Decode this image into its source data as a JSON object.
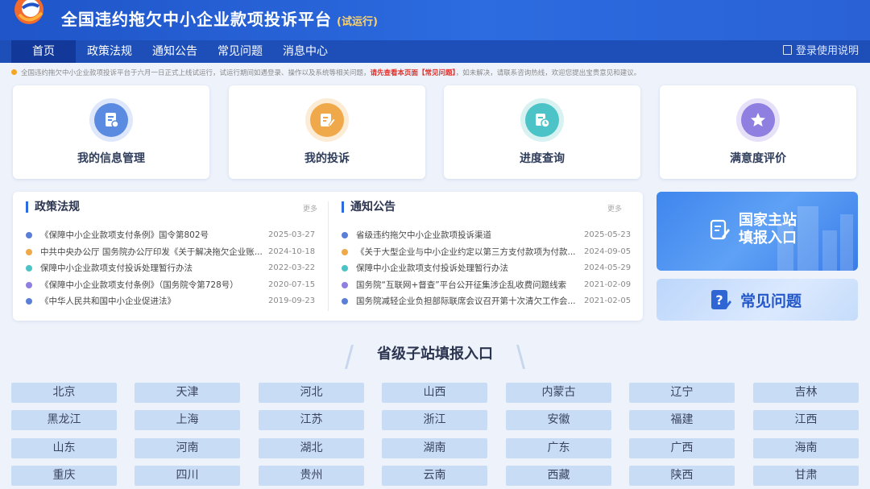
{
  "header": {
    "title": "全国违约拖欠中小企业款项投诉平台",
    "badge": "(试运行)"
  },
  "nav": {
    "items": [
      "首页",
      "政策法规",
      "通知公告",
      "常见问题",
      "消息中心"
    ],
    "login": "登录使用说明"
  },
  "notice": {
    "text_before": "全国违约拖欠中小企业款项投诉平台于六月一日正式上线试运行，试运行期间如遇登录、操作以及系统等相关问题，",
    "highlight": "请先查看本页面【常见问题】",
    "text_after": "，如未解决，请联系咨询热线，欢迎您提出宝贵意见和建议。"
  },
  "cards": [
    {
      "label": "我的信息管理",
      "icon": "profile-doc-icon",
      "color": "#5b8be0"
    },
    {
      "label": "我的投诉",
      "icon": "complaint-edit-icon",
      "color": "#f0a94a"
    },
    {
      "label": "进度查询",
      "icon": "progress-clock-icon",
      "color": "#4cc3c6"
    },
    {
      "label": "满意度评价",
      "icon": "star-icon",
      "color": "#8f7fe0"
    }
  ],
  "policy": {
    "title": "政策法规",
    "more": "更多",
    "items": [
      {
        "text": "《保障中小企业款项支付条例》国令第802号",
        "date": "2025-03-27",
        "color": "#5b7fd6"
      },
      {
        "text": "中共中央办公厅 国务院办公厅印发《关于解决拖欠企业账...",
        "date": "2024-10-18",
        "color": "#f0a94a"
      },
      {
        "text": "保障中小企业款项支付投诉处理暂行办法",
        "date": "2022-03-22",
        "color": "#4cc3c6"
      },
      {
        "text": "《保障中小企业款项支付条例》（国务院令第728号）",
        "date": "2020-07-15",
        "color": "#8f7fe0"
      },
      {
        "text": "《中华人民共和国中小企业促进法》",
        "date": "2019-09-23",
        "color": "#5b7fd6"
      }
    ]
  },
  "announce": {
    "title": "通知公告",
    "more": "更多",
    "items": [
      {
        "text": "省级违约拖欠中小企业款项投诉渠道",
        "date": "2025-05-23",
        "color": "#5b7fd6"
      },
      {
        "text": "《关于大型企业与中小企业约定以第三方支付款项为付款...",
        "date": "2024-09-05",
        "color": "#f0a94a"
      },
      {
        "text": "保障中小企业款项支付投诉处理暂行办法",
        "date": "2024-05-29",
        "color": "#4cc3c6"
      },
      {
        "text": "国务院“互联网+督查”平台公开征集涉企乱收费问题线索",
        "date": "2021-02-09",
        "color": "#8f7fe0"
      },
      {
        "text": "国务院减轻企业负担部际联席会议召开第十次清欠工作会...",
        "date": "2021-02-05",
        "color": "#5b7fd6"
      }
    ]
  },
  "side": {
    "main_line1": "国家主站",
    "main_line2": "填报入口",
    "faq": "常见问题"
  },
  "provinces": {
    "title": "省级子站填报入口",
    "items": [
      "北京",
      "天津",
      "河北",
      "山西",
      "内蒙古",
      "辽宁",
      "吉林",
      "黑龙江",
      "上海",
      "江苏",
      "浙江",
      "安徽",
      "福建",
      "江西",
      "山东",
      "河南",
      "湖北",
      "湖南",
      "广东",
      "广西",
      "海南",
      "重庆",
      "四川",
      "贵州",
      "云南",
      "西藏",
      "陕西",
      "甘肃"
    ]
  }
}
